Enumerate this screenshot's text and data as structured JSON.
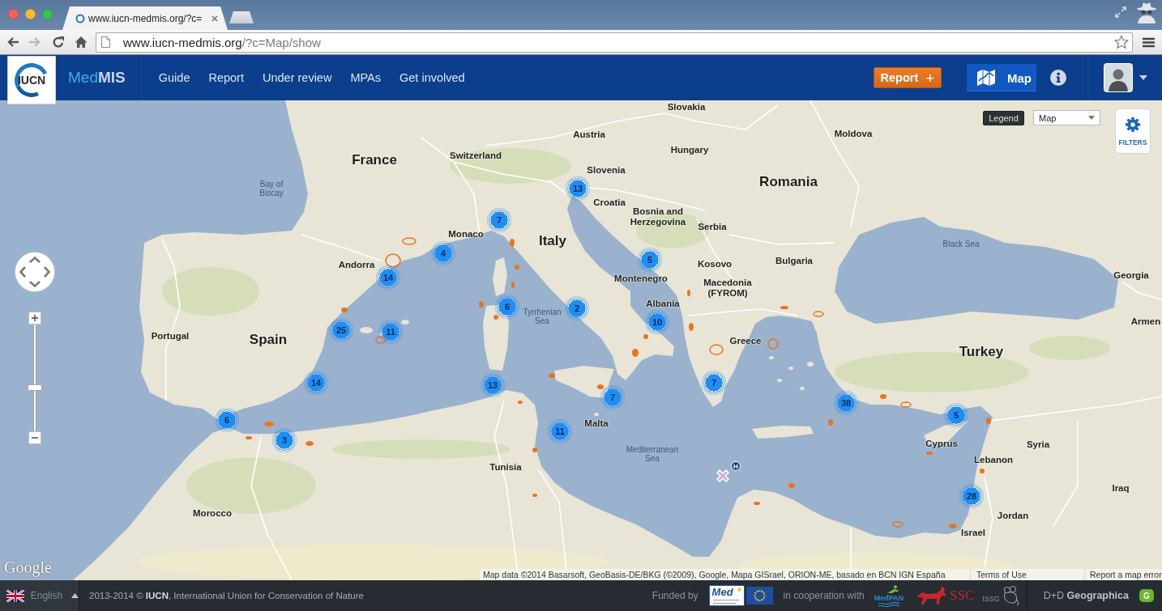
{
  "browser": {
    "tabs": [
      {
        "title": "www.iucn-medmis.org/?c=",
        "selected": true
      }
    ],
    "forward_disabled": true,
    "address": {
      "host": "www.iucn-medmis.org",
      "path": "/?c=Map/show"
    }
  },
  "header": {
    "logo": "IUCN",
    "brand": {
      "prefix": "Med",
      "suffix": "MIS"
    },
    "nav": [
      {
        "label": "Guide"
      },
      {
        "label": "Report"
      },
      {
        "label": "Under review"
      },
      {
        "label": "MPAs"
      },
      {
        "label": "Get involved"
      }
    ],
    "report_button": {
      "label": "Report",
      "suffix": "+"
    },
    "map_button": {
      "label": "Map",
      "selected": true
    }
  },
  "map": {
    "labels": [
      {
        "text": "Slovakia",
        "kind": "minor"
      },
      {
        "text": "Austria",
        "kind": "minor"
      },
      {
        "text": "Moldova",
        "kind": "minor"
      },
      {
        "text": "Hungary",
        "kind": "minor"
      },
      {
        "text": "France",
        "kind": "major"
      },
      {
        "text": "Switzerland",
        "kind": "minor"
      },
      {
        "text": "Slovenia",
        "kind": "minor"
      },
      {
        "text": "Bay of\nBiscay",
        "kind": "water"
      },
      {
        "text": "Romania",
        "kind": "major"
      },
      {
        "text": "Croatia",
        "kind": "minor"
      },
      {
        "text": "Bosnia and\nHerzegovina",
        "kind": "minor"
      },
      {
        "text": "Serbia",
        "kind": "minor"
      },
      {
        "text": "Monaco",
        "kind": "minor"
      },
      {
        "text": "Italy",
        "kind": "major"
      },
      {
        "text": "Black Sea",
        "kind": "water"
      },
      {
        "text": "Andorra",
        "kind": "minor"
      },
      {
        "text": "Kosovo",
        "kind": "minor"
      },
      {
        "text": "Bulgaria",
        "kind": "minor"
      },
      {
        "text": "Montenegro",
        "kind": "minor"
      },
      {
        "text": "Georgia",
        "kind": "minor"
      },
      {
        "text": "Macedonia\n(FYROM)",
        "kind": "minor"
      },
      {
        "text": "Albania",
        "kind": "minor"
      },
      {
        "text": "Tyrrhenian\nSea",
        "kind": "water"
      },
      {
        "text": "Armen",
        "kind": "minor"
      },
      {
        "text": "Portugal",
        "kind": "minor"
      },
      {
        "text": "Spain",
        "kind": "major"
      },
      {
        "text": "Greece",
        "kind": "minor"
      },
      {
        "text": "Turkey",
        "kind": "major"
      },
      {
        "text": "Malta",
        "kind": "minor"
      },
      {
        "text": "Cyprus",
        "kind": "minor"
      },
      {
        "text": "Syria",
        "kind": "minor"
      },
      {
        "text": "Mediterranean\nSea",
        "kind": "water"
      },
      {
        "text": "Lebanon",
        "kind": "minor"
      },
      {
        "text": "Tunisia",
        "kind": "minor"
      },
      {
        "text": "Iraq",
        "kind": "minor"
      },
      {
        "text": "Morocco",
        "kind": "minor"
      },
      {
        "text": "Jordan",
        "kind": "minor"
      },
      {
        "text": "Israel",
        "kind": "minor"
      }
    ],
    "clusters": [
      {
        "count": "13"
      },
      {
        "count": "7"
      },
      {
        "count": "4"
      },
      {
        "count": "5"
      },
      {
        "count": "14"
      },
      {
        "count": "6"
      },
      {
        "count": "2"
      },
      {
        "count": "25"
      },
      {
        "count": "11"
      },
      {
        "count": "10"
      },
      {
        "count": "14"
      },
      {
        "count": "13"
      },
      {
        "count": "7"
      },
      {
        "count": "7"
      },
      {
        "count": "38"
      },
      {
        "count": "6"
      },
      {
        "count": "5"
      },
      {
        "count": "3"
      },
      {
        "count": "11"
      },
      {
        "count": "28"
      }
    ],
    "special_marker": {
      "badge": "H"
    },
    "controls": {
      "legend": "Legend",
      "map_type": "Map",
      "filters": "FILTERS",
      "zoom": {
        "level": 0.41
      }
    },
    "provider_logo": "Google",
    "attribution": {
      "data": "Map data ©2014 Basarsoft, GeoBasis-DE/BKG (©2009), Google, Mapa GISrael, ORION-ME, basado en BCN IGN España",
      "terms": "Terms of Use",
      "report": "Report a map error"
    }
  },
  "footer": {
    "language": "English",
    "copyright": "2013-2014 © **IUCN**, International Union for Conservation of Nature",
    "funded_by": "Funded by",
    "funder_logo": "Med",
    "cooperation": "in cooperation with",
    "partners": [
      {
        "kind": "medpan",
        "name": "MedPAN"
      },
      {
        "kind": "ssc",
        "name": "SSC"
      },
      {
        "kind": "issg",
        "name": "ISSG"
      }
    ],
    "credit": "D+D **Geographica**",
    "credit_badge": "G"
  }
}
